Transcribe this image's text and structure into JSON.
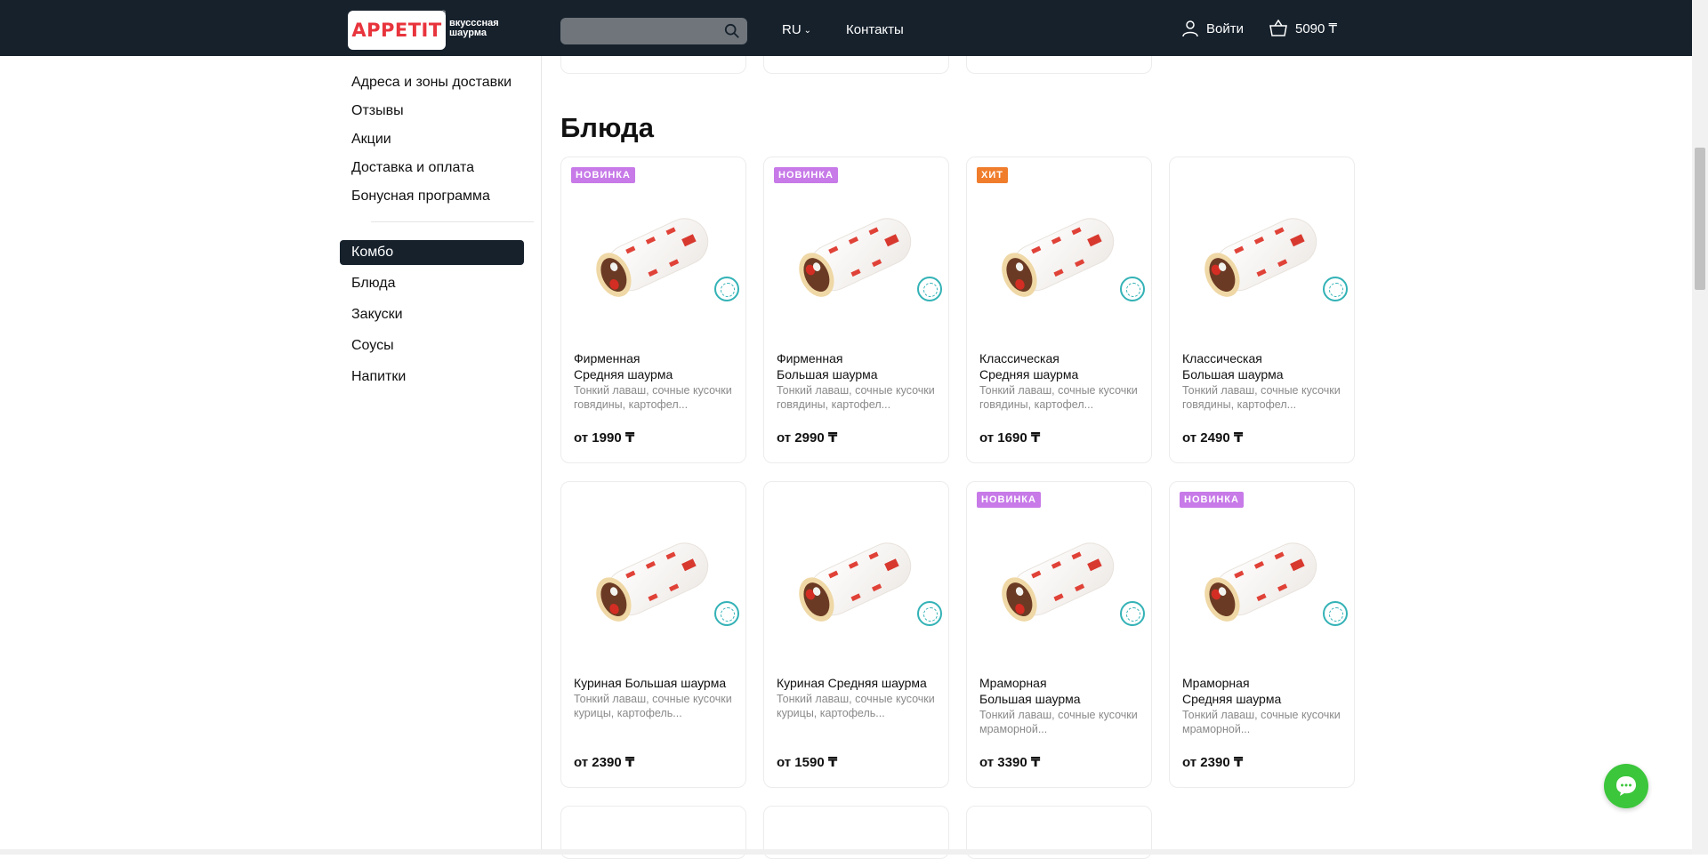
{
  "header": {
    "logo_text": "APPETIT",
    "logo_reg": "®",
    "tagline": "вкусссная шаурма",
    "search_placeholder": "",
    "lang": "RU",
    "contacts": "Контакты",
    "login": "Войти",
    "cart_total": "5090 ₸"
  },
  "sidebar": {
    "info_links": [
      "Адреса и зоны доставки",
      "Отзывы",
      "Акции",
      "Доставка и оплата",
      "Бонусная программа"
    ],
    "categories": [
      "Комбо",
      "Блюда",
      "Закуски",
      "Соусы",
      "Напитки"
    ],
    "active_category": "Комбо"
  },
  "section": {
    "title": "Блюда"
  },
  "products": [
    {
      "badge": "НОВИНКА",
      "badge_type": "new",
      "name": "Фирменная\nСредняя шаурма",
      "desc": "Тонкий лаваш, сочные кусочки говядины, картофел...",
      "price": "от 1990 ₸"
    },
    {
      "badge": "НОВИНКА",
      "badge_type": "new",
      "name": "Фирменная\nБольшая шаурма",
      "desc": "Тонкий лаваш, сочные кусочки говядины, картофел...",
      "price": "от 2990 ₸"
    },
    {
      "badge": "ХИТ",
      "badge_type": "hit",
      "name": "Классическая\nСредняя шаурма",
      "desc": "Тонкий лаваш, сочные кусочки говядины, картофел...",
      "price": "от 1690 ₸"
    },
    {
      "badge": "",
      "badge_type": "",
      "name": "Классическая\nБольшая шаурма",
      "desc": "Тонкий лаваш, сочные кусочки говядины, картофел...",
      "price": "от 2490 ₸"
    },
    {
      "badge": "",
      "badge_type": "",
      "name": "Куриная Большая шаурма",
      "desc": "Тонкий лаваш, сочные кусочки курицы, картофель...",
      "price": "от 2390 ₸"
    },
    {
      "badge": "",
      "badge_type": "",
      "name": "Куриная Средняя шаурма",
      "desc": "Тонкий лаваш, сочные кусочки курицы, картофель...",
      "price": "от 1590 ₸"
    },
    {
      "badge": "НОВИНКА",
      "badge_type": "new",
      "name": "Мраморная\nБольшая шаурма",
      "desc": "Тонкий лаваш, сочные кусочки мраморной...",
      "price": "от 3390 ₸"
    },
    {
      "badge": "НОВИНКА",
      "badge_type": "new",
      "name": "Мраморная\nСредняя шаурма",
      "desc": "Тонкий лаваш, сочные кусочки мраморной...",
      "price": "от 2390 ₸"
    }
  ],
  "colors": {
    "header_bg": "#16212c",
    "brand_red": "#e8343c",
    "badge_new": "#c77ae8",
    "badge_hit": "#f07d2c",
    "chat_green": "#3bc63b"
  }
}
